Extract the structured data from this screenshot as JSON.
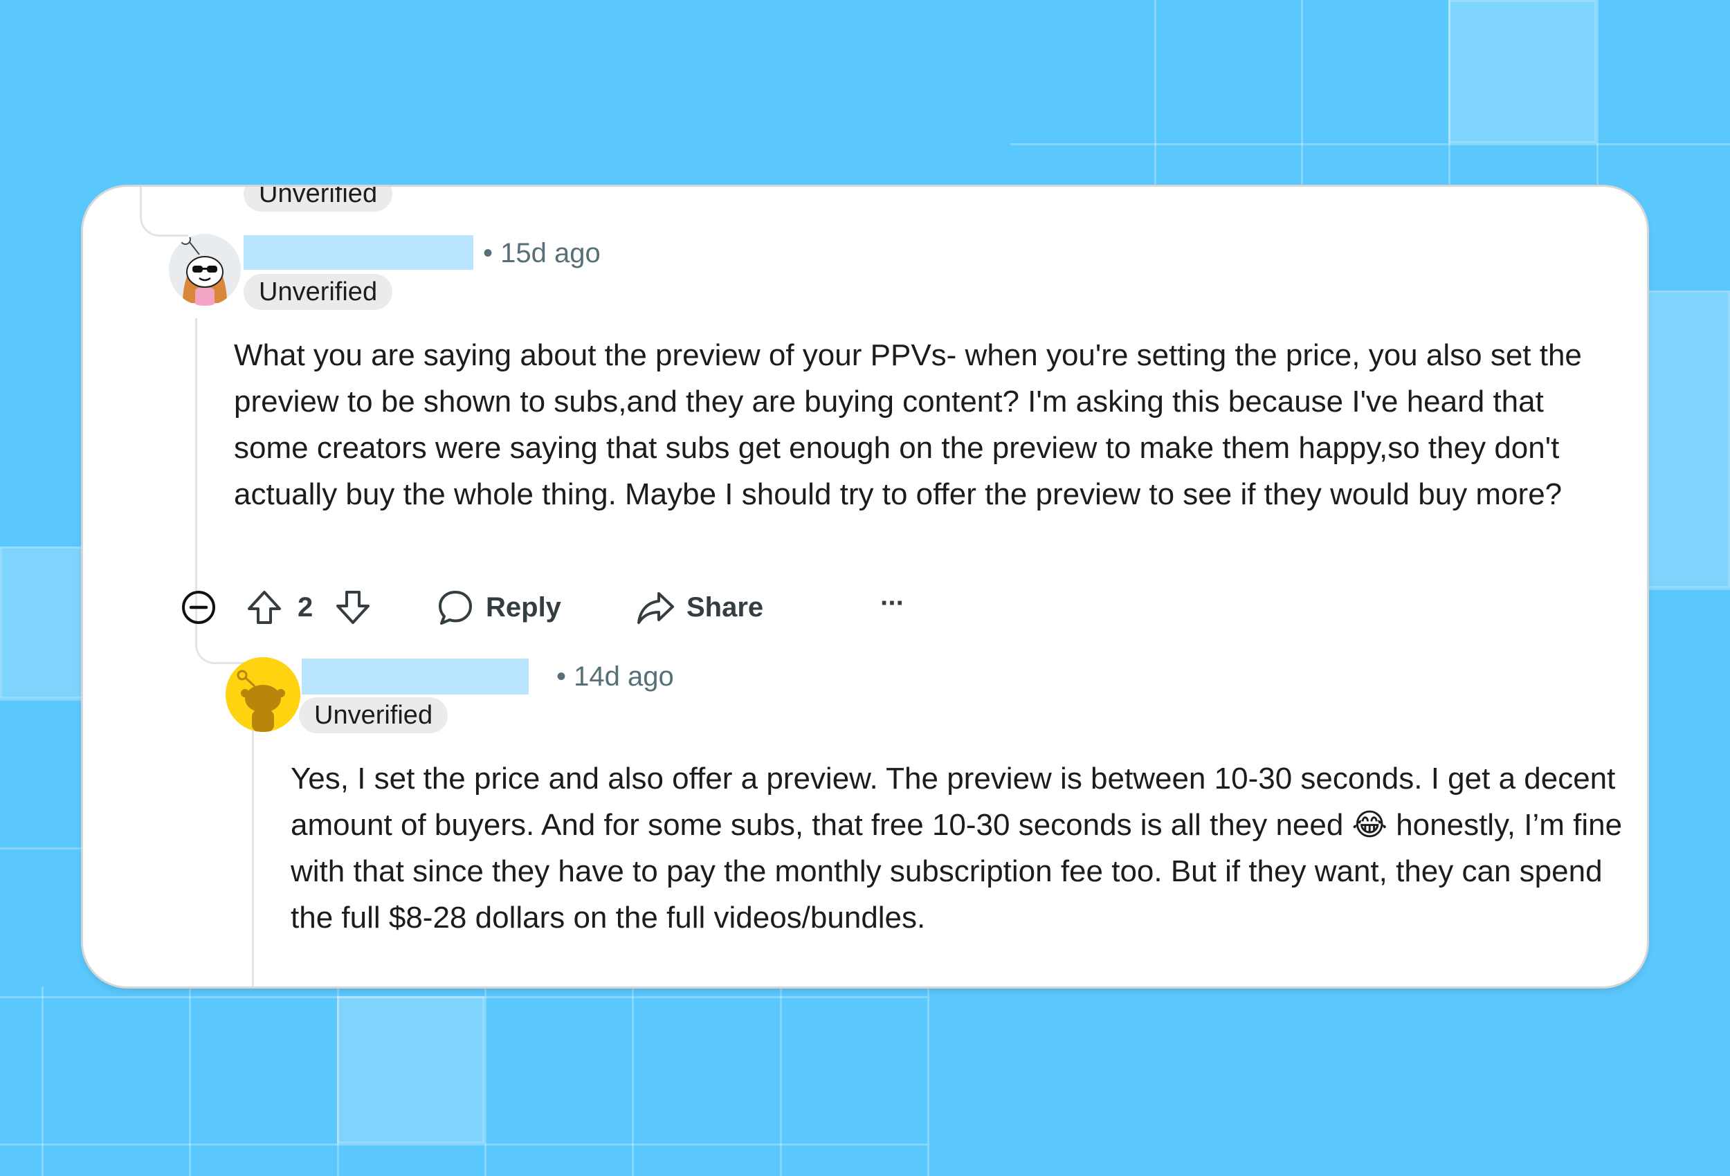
{
  "comments": [
    {
      "previous_badge": "Unverified",
      "timestamp": "15d ago",
      "separator": "•",
      "badge": "Unverified",
      "body": "What you are saying about the preview of your PPVs- when you're setting the price, you also set the preview to be shown to subs,and they are buying content? I'm asking this because I've heard that some creators were saying that subs get enough on the preview to make them happy,so they don't actually buy the whole thing. Maybe I should try to offer the preview to see if they would buy more?",
      "vote_count": "2",
      "reply_label": "Reply",
      "share_label": "Share",
      "more_label": "···"
    },
    {
      "timestamp": "14d ago",
      "separator": "•",
      "badge": "Unverified",
      "body": "Yes, I set the price and also offer a preview. The preview is between 10-30 seconds. I get a decent amount of buyers. And for some subs, that free 10-30 seconds is all they need 😂 honestly, I’m fine with that since they have to pay the monthly subscription fee too. But if they want, they can spend the full $8-28 dollars on the full videos/bundles."
    }
  ],
  "colors": {
    "background": "#5bc8fd",
    "card": "#ffffff",
    "redaction": "#b9e6fe",
    "badge_bg": "#e9ebed",
    "meta_text": "#576f76",
    "body_text": "#1c1c1c"
  },
  "icons": {
    "collapse": "minus-circle-icon",
    "upvote": "arrow-up-icon",
    "downvote": "arrow-down-icon",
    "reply": "speech-bubble-icon",
    "share": "share-arrow-icon",
    "more": "ellipsis-icon"
  }
}
